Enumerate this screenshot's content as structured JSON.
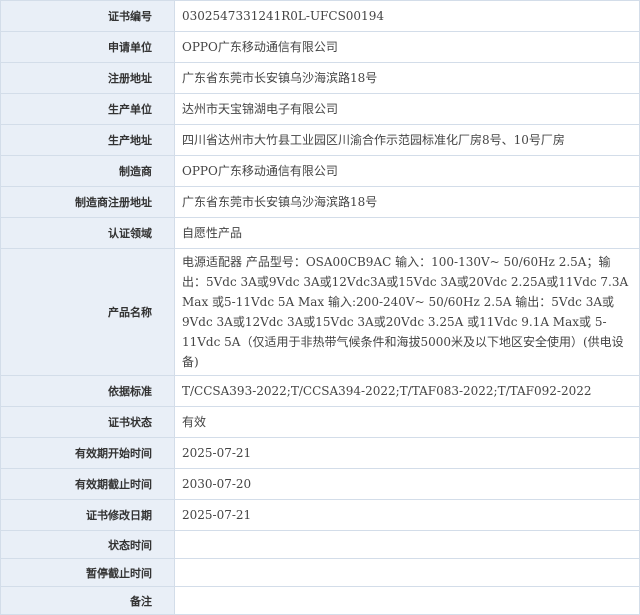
{
  "rows": [
    {
      "label": "证书编号",
      "value": "0302547331241R0L-UFCS00194"
    },
    {
      "label": "申请单位",
      "value": "OPPO广东移动通信有限公司"
    },
    {
      "label": "注册地址",
      "value": "广东省东莞市长安镇乌沙海滨路18号"
    },
    {
      "label": "生产单位",
      "value": "达州市天宝锦湖电子有限公司"
    },
    {
      "label": "生产地址",
      "value": "四川省达州市大竹县工业园区川渝合作示范园标准化厂房8号、10号厂房"
    },
    {
      "label": "制造商",
      "value": "OPPO广东移动通信有限公司"
    },
    {
      "label": "制造商注册地址",
      "value": "广东省东莞市长安镇乌沙海滨路18号"
    },
    {
      "label": "认证领域",
      "value": "自愿性产品"
    },
    {
      "label": "产品名称",
      "value": "电源适配器 产品型号：OSA00CB9AC 输入：100-130V~ 50/60Hz 2.5A；输出：5Vdc 3A或9Vdc 3A或12Vdc3A或15Vdc 3A或20Vdc 2.25A或11Vdc 7.3A Max 或5-11Vdc 5A Max 输入:200-240V~ 50/60Hz 2.5A 输出：5Vdc 3A或9Vdc 3A或12Vdc 3A或15Vdc 3A或20Vdc 3.25A 或11Vdc 9.1A Max或 5-11Vdc 5A（仅适用于非热带气候条件和海拔5000米及以下地区安全使用）(供电设备)"
    },
    {
      "label": "依据标准",
      "value": "T/CCSA393-2022;T/CCSA394-2022;T/TAF083-2022;T/TAF092-2022"
    },
    {
      "label": "证书状态",
      "value": "有效"
    },
    {
      "label": "有效期开始时间",
      "value": "2025-07-21"
    },
    {
      "label": "有效期截止时间",
      "value": "2030-07-20"
    },
    {
      "label": "证书修改日期",
      "value": "2025-07-21"
    },
    {
      "label": "状态时间",
      "value": ""
    },
    {
      "label": "暂停截止时间",
      "value": ""
    },
    {
      "label": "备注",
      "value": ""
    }
  ]
}
